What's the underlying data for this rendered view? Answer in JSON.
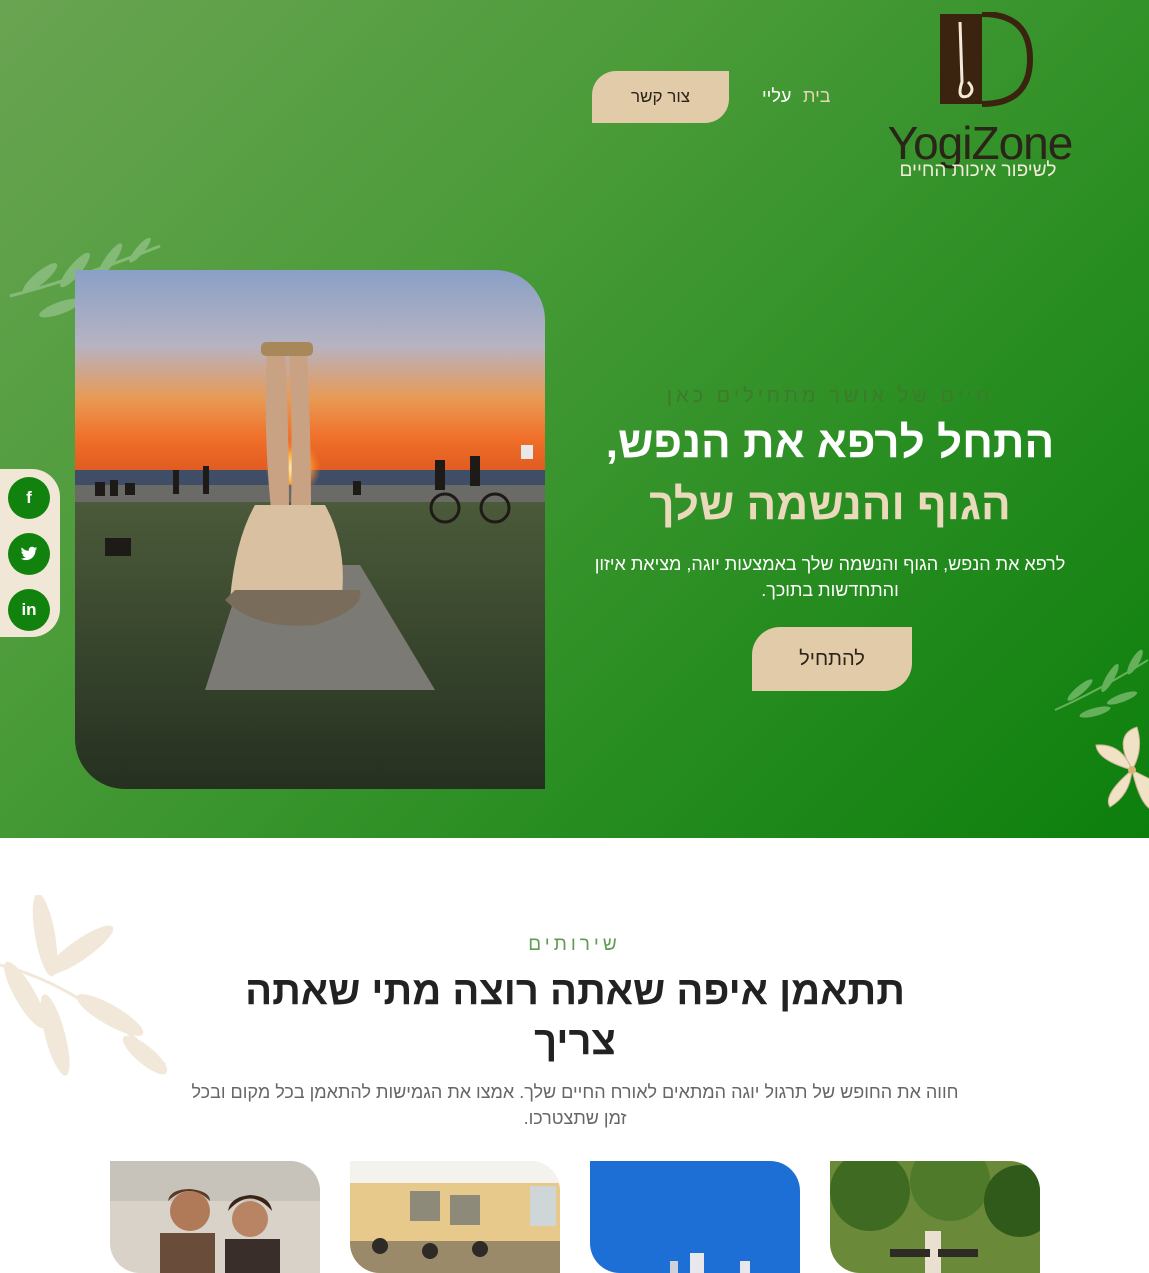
{
  "brand": {
    "name": "YogiZone",
    "tagline": "לשיפור איכות החיים"
  },
  "nav": {
    "home": "בית",
    "about": "עליי",
    "contact": "צור קשר"
  },
  "hero": {
    "eyebrow": "חיים של אושר מתחילים כאן",
    "title_line1": "התחל לרפא את הנפש,",
    "title_line2": "הגוף והנשמה שלך",
    "description": "לרפא את הנפש, הגוף והנשמה שלך באמצעות יוגה, מציאת איזון והתחדשות בתוכך.",
    "cta": "להתחיל"
  },
  "social": {
    "facebook": "f",
    "twitter": "twitter-icon",
    "linkedin": "in"
  },
  "services": {
    "eyebrow": "שירותים",
    "title": "תתאמן איפה שאתה רוצה מתי שאתה צריך",
    "description": "חווה את החופש של תרגול יוגה המתאים לאורח החיים שלך. אמצו את הגמישות להתאמן בכל מקום ובכל זמן שתצטרכו."
  },
  "colors": {
    "accent": "#e2cba9",
    "green": "#12820e",
    "dark": "#2b2418"
  }
}
